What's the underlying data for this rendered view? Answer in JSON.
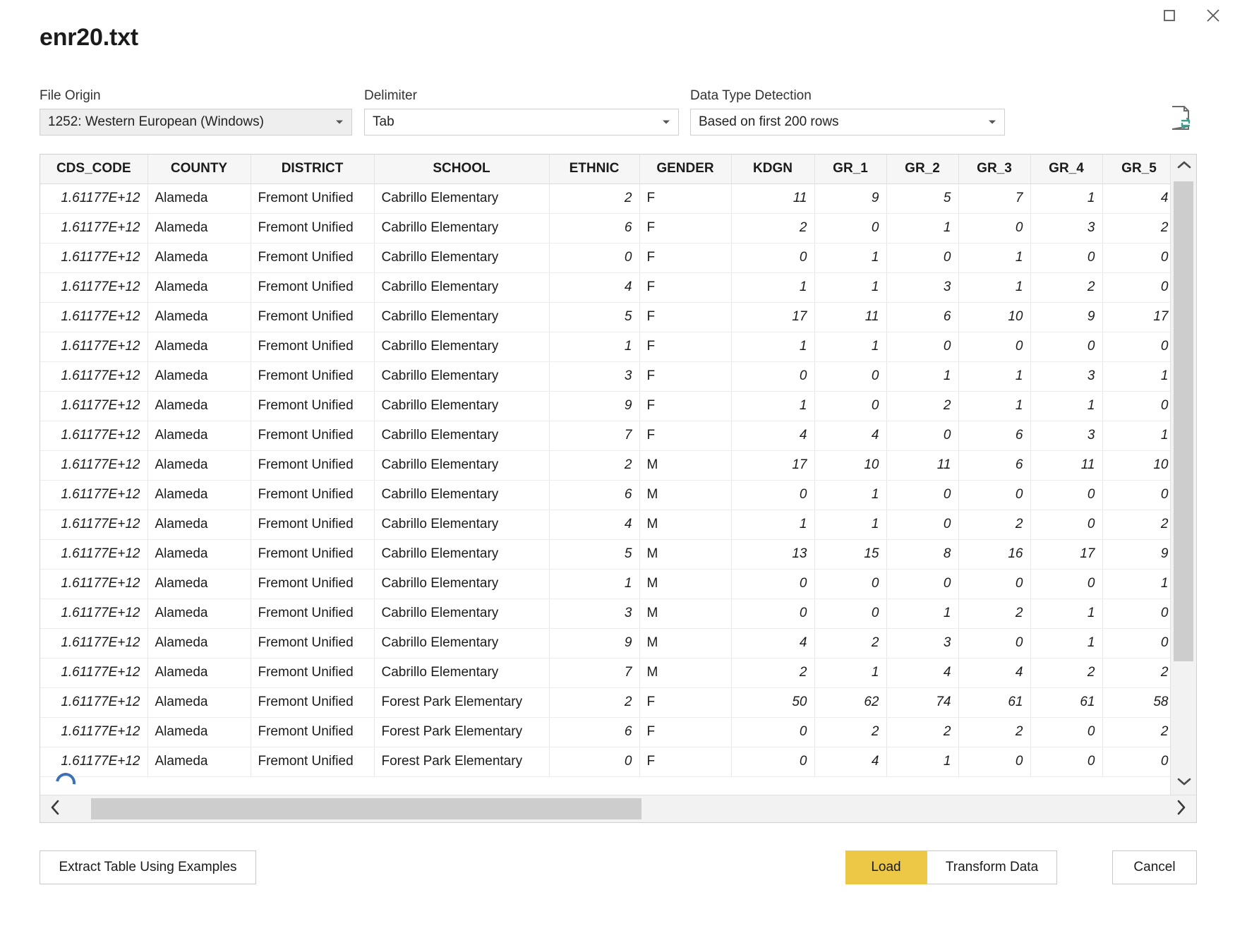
{
  "window": {
    "title": "enr20.txt",
    "maximize_icon": "maximize-icon",
    "close_icon": "close-icon"
  },
  "options": {
    "file_origin": {
      "label": "File Origin",
      "value": "1252: Western European (Windows)"
    },
    "delimiter": {
      "label": "Delimiter",
      "value": "Tab"
    },
    "data_type_detection": {
      "label": "Data Type Detection",
      "value": "Based on first 200 rows"
    },
    "refresh_icon": "file-refresh-icon"
  },
  "table": {
    "columns": [
      "CDS_CODE",
      "COUNTY",
      "DISTRICT",
      "SCHOOL",
      "ETHNIC",
      "GENDER",
      "KDGN",
      "GR_1",
      "GR_2",
      "GR_3",
      "GR_4",
      "GR_5"
    ],
    "rows": [
      [
        "1.61177E+12",
        "Alameda",
        "Fremont Unified",
        "Cabrillo Elementary",
        "2",
        "F",
        "11",
        "9",
        "5",
        "7",
        "1",
        "4"
      ],
      [
        "1.61177E+12",
        "Alameda",
        "Fremont Unified",
        "Cabrillo Elementary",
        "6",
        "F",
        "2",
        "0",
        "1",
        "0",
        "3",
        "2"
      ],
      [
        "1.61177E+12",
        "Alameda",
        "Fremont Unified",
        "Cabrillo Elementary",
        "0",
        "F",
        "0",
        "1",
        "0",
        "1",
        "0",
        "0"
      ],
      [
        "1.61177E+12",
        "Alameda",
        "Fremont Unified",
        "Cabrillo Elementary",
        "4",
        "F",
        "1",
        "1",
        "3",
        "1",
        "2",
        "0"
      ],
      [
        "1.61177E+12",
        "Alameda",
        "Fremont Unified",
        "Cabrillo Elementary",
        "5",
        "F",
        "17",
        "11",
        "6",
        "10",
        "9",
        "17"
      ],
      [
        "1.61177E+12",
        "Alameda",
        "Fremont Unified",
        "Cabrillo Elementary",
        "1",
        "F",
        "1",
        "1",
        "0",
        "0",
        "0",
        "0"
      ],
      [
        "1.61177E+12",
        "Alameda",
        "Fremont Unified",
        "Cabrillo Elementary",
        "3",
        "F",
        "0",
        "0",
        "1",
        "1",
        "3",
        "1"
      ],
      [
        "1.61177E+12",
        "Alameda",
        "Fremont Unified",
        "Cabrillo Elementary",
        "9",
        "F",
        "1",
        "0",
        "2",
        "1",
        "1",
        "0"
      ],
      [
        "1.61177E+12",
        "Alameda",
        "Fremont Unified",
        "Cabrillo Elementary",
        "7",
        "F",
        "4",
        "4",
        "0",
        "6",
        "3",
        "1"
      ],
      [
        "1.61177E+12",
        "Alameda",
        "Fremont Unified",
        "Cabrillo Elementary",
        "2",
        "M",
        "17",
        "10",
        "11",
        "6",
        "11",
        "10"
      ],
      [
        "1.61177E+12",
        "Alameda",
        "Fremont Unified",
        "Cabrillo Elementary",
        "6",
        "M",
        "0",
        "1",
        "0",
        "0",
        "0",
        "0"
      ],
      [
        "1.61177E+12",
        "Alameda",
        "Fremont Unified",
        "Cabrillo Elementary",
        "4",
        "M",
        "1",
        "1",
        "0",
        "2",
        "0",
        "2"
      ],
      [
        "1.61177E+12",
        "Alameda",
        "Fremont Unified",
        "Cabrillo Elementary",
        "5",
        "M",
        "13",
        "15",
        "8",
        "16",
        "17",
        "9"
      ],
      [
        "1.61177E+12",
        "Alameda",
        "Fremont Unified",
        "Cabrillo Elementary",
        "1",
        "M",
        "0",
        "0",
        "0",
        "0",
        "0",
        "1"
      ],
      [
        "1.61177E+12",
        "Alameda",
        "Fremont Unified",
        "Cabrillo Elementary",
        "3",
        "M",
        "0",
        "0",
        "1",
        "2",
        "1",
        "0"
      ],
      [
        "1.61177E+12",
        "Alameda",
        "Fremont Unified",
        "Cabrillo Elementary",
        "9",
        "M",
        "4",
        "2",
        "3",
        "0",
        "1",
        "0"
      ],
      [
        "1.61177E+12",
        "Alameda",
        "Fremont Unified",
        "Cabrillo Elementary",
        "7",
        "M",
        "2",
        "1",
        "4",
        "4",
        "2",
        "2"
      ],
      [
        "1.61177E+12",
        "Alameda",
        "Fremont Unified",
        "Forest Park Elementary",
        "2",
        "F",
        "50",
        "62",
        "74",
        "61",
        "61",
        "58"
      ],
      [
        "1.61177E+12",
        "Alameda",
        "Fremont Unified",
        "Forest Park Elementary",
        "6",
        "F",
        "0",
        "2",
        "2",
        "2",
        "0",
        "2"
      ],
      [
        "1.61177E+12",
        "Alameda",
        "Fremont Unified",
        "Forest Park Elementary",
        "0",
        "F",
        "0",
        "4",
        "1",
        "0",
        "0",
        "0"
      ]
    ]
  },
  "scrollbars": {
    "vertical_up_icon": "chevron-up-icon",
    "vertical_down_icon": "chevron-down-icon",
    "horizontal_left_icon": "chevron-left-icon",
    "horizontal_right_icon": "chevron-right-icon"
  },
  "footer": {
    "extract_label": "Extract Table Using Examples",
    "load_label": "Load",
    "transform_label": "Transform Data",
    "cancel_label": "Cancel"
  },
  "colors": {
    "load_accent": "#ecc846",
    "refresh_accent": "#3f9d8f",
    "spinner": "#3d6fb4"
  }
}
